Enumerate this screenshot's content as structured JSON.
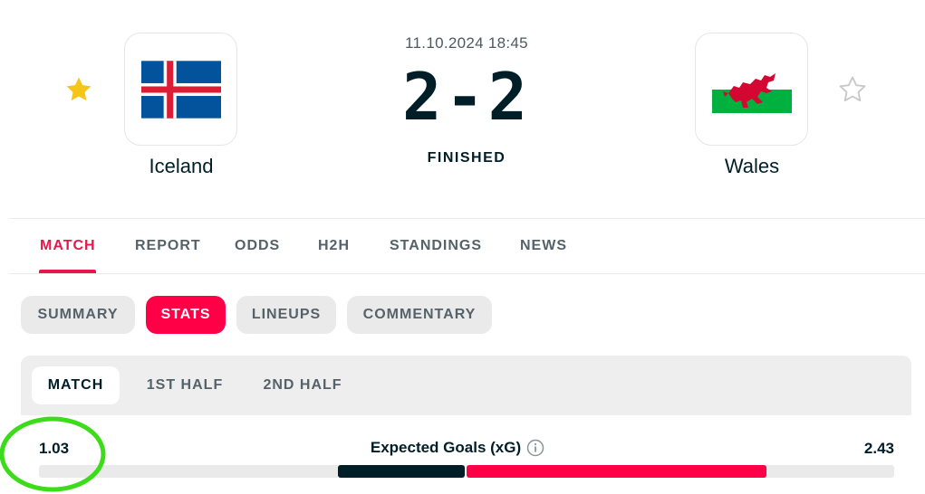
{
  "match": {
    "datetime": "11.10.2024 18:45",
    "score": "2-2",
    "status": "FINISHED",
    "home": {
      "name": "Iceland",
      "favorite": true
    },
    "away": {
      "name": "Wales",
      "favorite": false
    }
  },
  "colors": {
    "accent": "#ff0046",
    "accent_text": "#e8174b",
    "dark": "#001e28",
    "star_active": "#f5c518",
    "star_inactive": "#c8c8c8",
    "annotation": "#3ddc1a"
  },
  "icons": {
    "favorite_home": "star-filled-icon",
    "favorite_away": "star-outline-icon",
    "info": "info-icon"
  },
  "main_tabs": [
    {
      "label": "MATCH",
      "active": true
    },
    {
      "label": "REPORT",
      "active": false
    },
    {
      "label": "ODDS",
      "active": false
    },
    {
      "label": "H2H",
      "active": false
    },
    {
      "label": "STANDINGS",
      "active": false
    },
    {
      "label": "NEWS",
      "active": false
    }
  ],
  "sub_tabs": [
    {
      "label": "SUMMARY",
      "active": false
    },
    {
      "label": "STATS",
      "active": true
    },
    {
      "label": "LINEUPS",
      "active": false
    },
    {
      "label": "COMMENTARY",
      "active": false
    }
  ],
  "periods": [
    {
      "label": "MATCH",
      "active": true
    },
    {
      "label": "1ST HALF",
      "active": false
    },
    {
      "label": "2ND HALF",
      "active": false
    }
  ],
  "stats": [
    {
      "label": "Expected Goals (xG)",
      "home": "1.03",
      "away": "2.43",
      "home_value": 1.03,
      "away_value": 2.43
    }
  ]
}
